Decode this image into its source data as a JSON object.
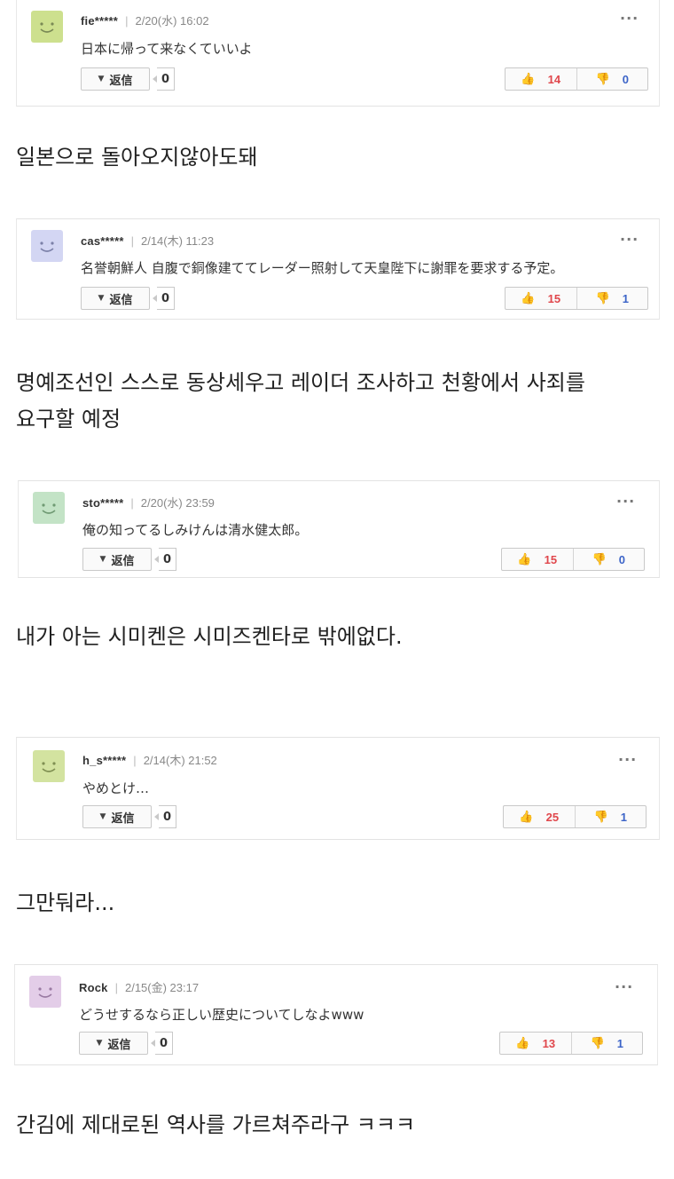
{
  "comments": [
    {
      "user": "fie*****",
      "date": "2/20(水) 16:02",
      "text": "日本に帰って来なくていいよ",
      "reply_label": "返信",
      "reply_count": "0",
      "likes": "14",
      "dislikes": "0",
      "avatar_color": "#cde08e",
      "translation": [
        "일본으로 돌아오지않아도돼"
      ]
    },
    {
      "user": "cas*****",
      "date": "2/14(木) 11:23",
      "text": "名誉朝鮮人 自腹で銅像建ててレーダー照射して天皇陛下に謝罪を要求する予定。",
      "reply_label": "返信",
      "reply_count": "0",
      "likes": "15",
      "dislikes": "1",
      "avatar_color": "#d3d6f3",
      "translation": [
        "명예조선인 스스로 동상세우고 레이더 조사하고 천황에서 사죄를",
        "요구할  예정"
      ]
    },
    {
      "user": "sto*****",
      "date": "2/20(水) 23:59",
      "text": "俺の知ってるしみけんは清水健太郎。",
      "reply_label": "返信",
      "reply_count": "0",
      "likes": "15",
      "dislikes": "0",
      "avatar_color": "#c3e3c6",
      "translation": [
        "내가 아는 시미켄은 시미즈켄타로 밖에없다."
      ]
    },
    {
      "user": "h_s*****",
      "date": "2/14(木) 21:52",
      "text": "やめとけ…",
      "reply_label": "返信",
      "reply_count": "0",
      "likes": "25",
      "dislikes": "1",
      "avatar_color": "#d3e3a0",
      "translation": [
        "그만둬라..."
      ]
    },
    {
      "user": "Rock",
      "date": "2/15(金) 23:17",
      "text": "どうせするなら正しい歴史についてしなよwww",
      "reply_label": "返信",
      "reply_count": "0",
      "likes": "13",
      "dislikes": "1",
      "avatar_color": "#e3cde8",
      "translation": [
        "간김에 제대로된 역사를 가르쳐주라구 ㅋㅋㅋ"
      ]
    }
  ],
  "icons": {
    "more": "more-icon",
    "reply": "caret-down-icon",
    "like": "thumbs-up-icon",
    "dislike": "thumbs-down-icon",
    "avatar": "smiley-avatar-icon"
  }
}
